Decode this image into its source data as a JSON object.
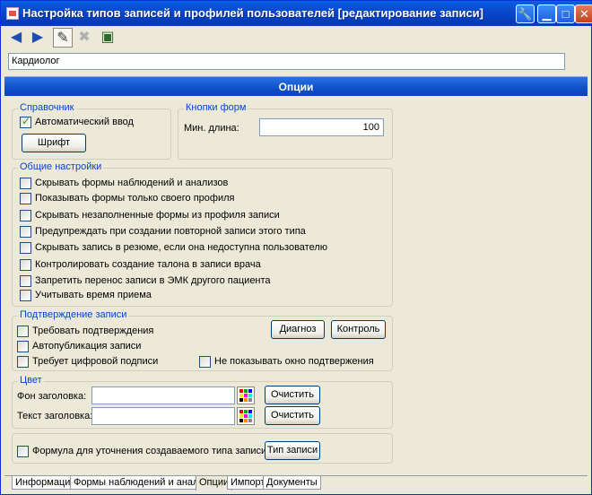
{
  "window": {
    "title": "Настройка типов записей и профилей пользователей [редактирование записи]",
    "controls": [
      "tools-icon",
      "minimize-icon",
      "maximize-icon",
      "close-icon"
    ]
  },
  "toolbar": {
    "icons": [
      "back-arrow-icon",
      "forward-arrow-icon",
      "edit-pencil-icon",
      "delete-icon",
      "close-record-icon"
    ]
  },
  "record_name": "Кардиолог",
  "panel_title": "Опции",
  "dictionary": {
    "legend": "Справочник",
    "auto_input_label": "Автоматический ввод",
    "auto_input_checked": true,
    "font_button": "Шрифт"
  },
  "form_buttons": {
    "legend": "Кнопки форм",
    "min_length_label": "Мин. длина:",
    "min_length_value": "100"
  },
  "general": {
    "legend": "Общие настройки",
    "options": [
      {
        "label": "Скрывать формы наблюдений и анализов",
        "checked": false
      },
      {
        "label": "Показывать формы только своего профиля",
        "checked": false
      },
      {
        "label": "Скрывать незаполненные формы из профиля записи",
        "checked": false
      },
      {
        "label": "Предупреждать при создании повторной записи этого типа",
        "checked": false
      },
      {
        "label": "Скрывать запись в резюме, если она недоступна пользователю",
        "checked": false
      },
      {
        "label": "Контролировать создание талона в записи врача",
        "checked": false
      },
      {
        "label": "Запретить перенос записи в  ЭМК другого пациента",
        "checked": false
      },
      {
        "label": "Учитывать время приема",
        "checked": false
      }
    ]
  },
  "confirmation": {
    "legend": "Подтверждение записи",
    "require_label": "Требовать подтверждения",
    "autopublish_label": "Автопубликация записи",
    "digital_sign_label": "Требует цифровой подписи",
    "hide_window_label": "Не показывать окно подтвержения",
    "diagnosis_button": "Диагноз",
    "control_button": "Контроль"
  },
  "color": {
    "legend": "Цвет",
    "header_bg_label": "Фон заголовка:",
    "header_bg_value": "",
    "header_text_label": "Текст заголовка:",
    "header_text_value": "",
    "clear_button": "Очистить"
  },
  "formula": {
    "label": "Формула для уточнения создаваемого типа записи",
    "record_type_button": "Тип записи"
  },
  "tabs": [
    {
      "label": "Информация"
    },
    {
      "label": "Формы наблюдений и анализов"
    },
    {
      "label": "Опции"
    },
    {
      "label": "Импорт"
    },
    {
      "label": "Документы"
    }
  ],
  "active_tab": "Опции"
}
